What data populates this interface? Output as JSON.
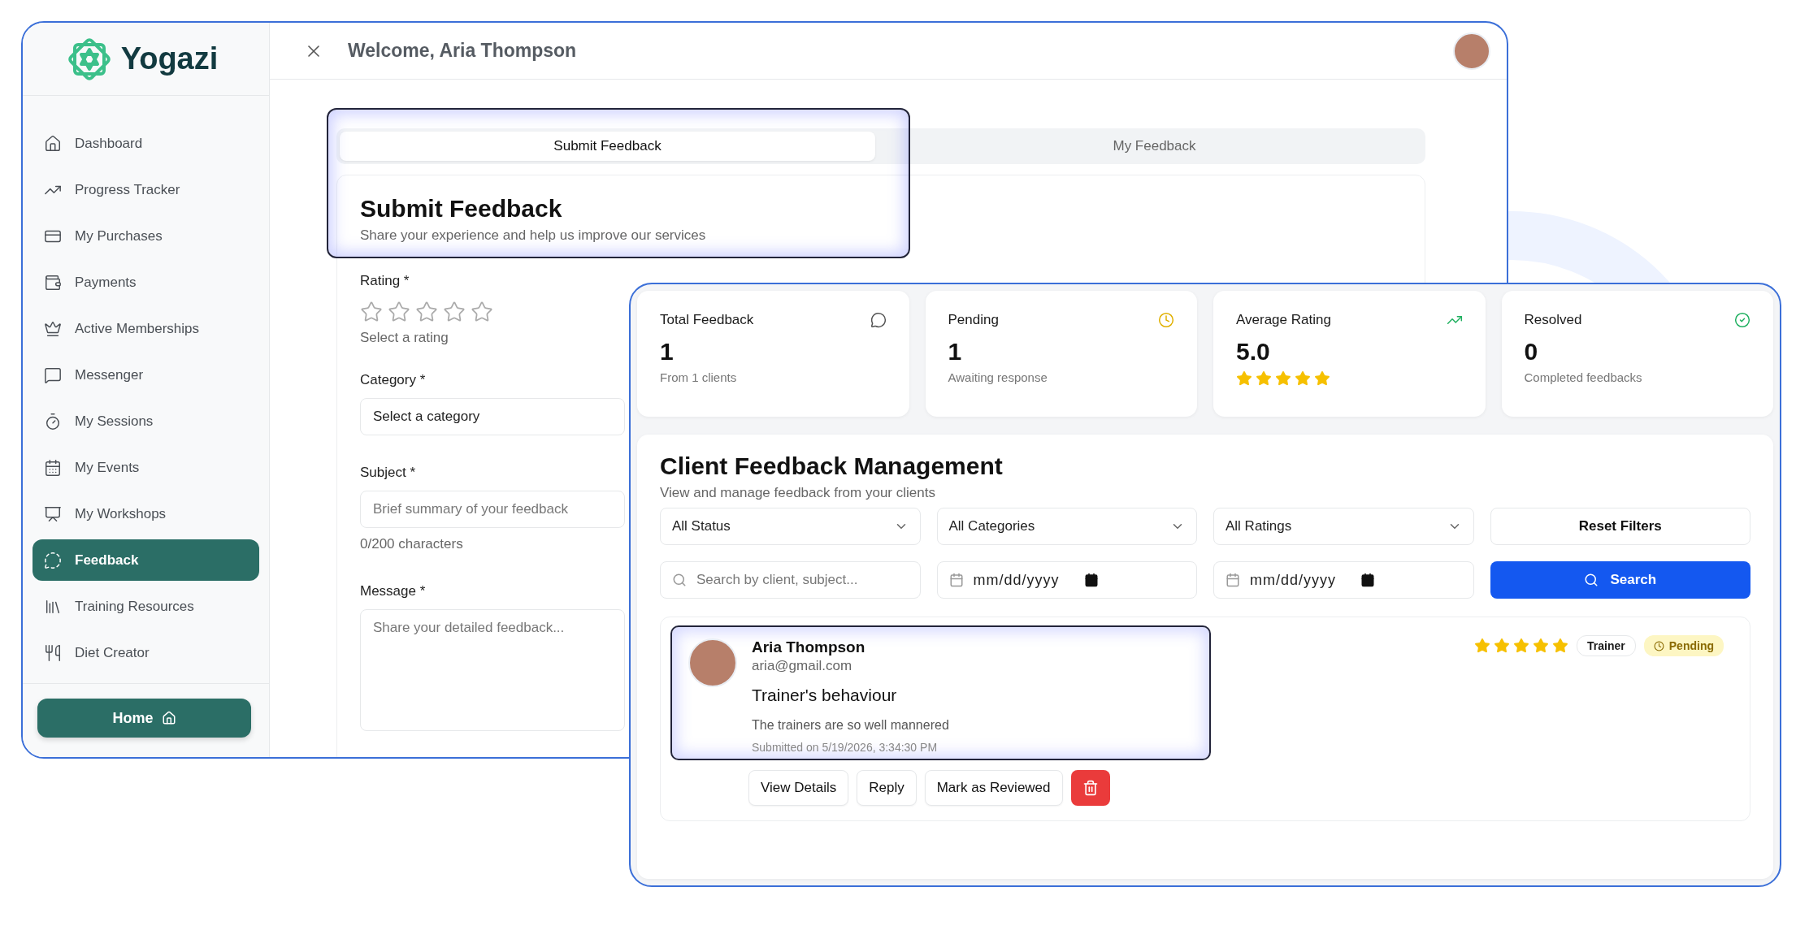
{
  "logo": {
    "name": "Yogazi"
  },
  "sidebar": {
    "items": [
      {
        "label": "Dashboard",
        "selected": false
      },
      {
        "label": "Progress Tracker",
        "selected": false
      },
      {
        "label": "My Purchases",
        "selected": false
      },
      {
        "label": "Payments",
        "selected": false
      },
      {
        "label": "Active Memberships",
        "selected": false
      },
      {
        "label": "Messenger",
        "selected": false
      },
      {
        "label": "My Sessions",
        "selected": false
      },
      {
        "label": "My Events",
        "selected": false
      },
      {
        "label": "My Workshops",
        "selected": false
      },
      {
        "label": "Feedback",
        "selected": true
      },
      {
        "label": "Training Resources",
        "selected": false
      },
      {
        "label": "Diet Creator",
        "selected": false
      }
    ],
    "home_button": "Home"
  },
  "header": {
    "welcome": "Welcome, Aria Thompson"
  },
  "tabs": [
    {
      "label": "Submit Feedback",
      "selected": true
    },
    {
      "label": "My Feedback",
      "selected": false
    }
  ],
  "submit_form": {
    "title": "Submit Feedback",
    "subtitle": "Share your experience and help us improve our services",
    "rating": {
      "label": "Rating *",
      "stars": 0,
      "hint": "Select a rating"
    },
    "category": {
      "label": "Category *",
      "value": "Select a category"
    },
    "subject": {
      "label": "Subject *",
      "placeholder": "Brief summary of your feedback",
      "counter": "0/200 characters"
    },
    "message": {
      "label": "Message *",
      "placeholder": "Share your detailed feedback..."
    }
  },
  "stats": [
    {
      "kind": "total",
      "title": "Total Feedback",
      "value": "1",
      "note": "From 1 clients"
    },
    {
      "kind": "pending",
      "title": "Pending",
      "value": "1",
      "note": "Awaiting response"
    },
    {
      "kind": "rating",
      "title": "Average Rating",
      "value": "5.0",
      "stars": 5
    },
    {
      "kind": "resolved",
      "title": "Resolved",
      "value": "0",
      "note": "Completed feedbacks"
    }
  ],
  "management": {
    "title": "Client Feedback Management",
    "subtitle": "View and manage feedback from your clients",
    "filters": [
      {
        "value": "All Status"
      },
      {
        "value": "All Categories"
      },
      {
        "value": "All Ratings"
      }
    ],
    "reset_button": "Reset Filters",
    "search": {
      "placeholder": "Search by client, subject..."
    },
    "dates": [
      {
        "value": "mm/dd/yyyy"
      },
      {
        "value": "mm/dd/yyyy"
      }
    ],
    "search_button": "Search",
    "feedback": [
      {
        "name": "Aria Thompson",
        "email": "aria@gmail.com",
        "subject": "Trainer's behaviour",
        "message": "The trainers are so well mannered",
        "submitted": "Submitted on 5/19/2026, 3:34:30 PM",
        "stars": 5,
        "tag": "Trainer",
        "status": {
          "kind": "pending",
          "label": "Pending"
        },
        "actions": [
          "View Details",
          "Reply",
          "Mark as Reviewed"
        ]
      }
    ]
  }
}
